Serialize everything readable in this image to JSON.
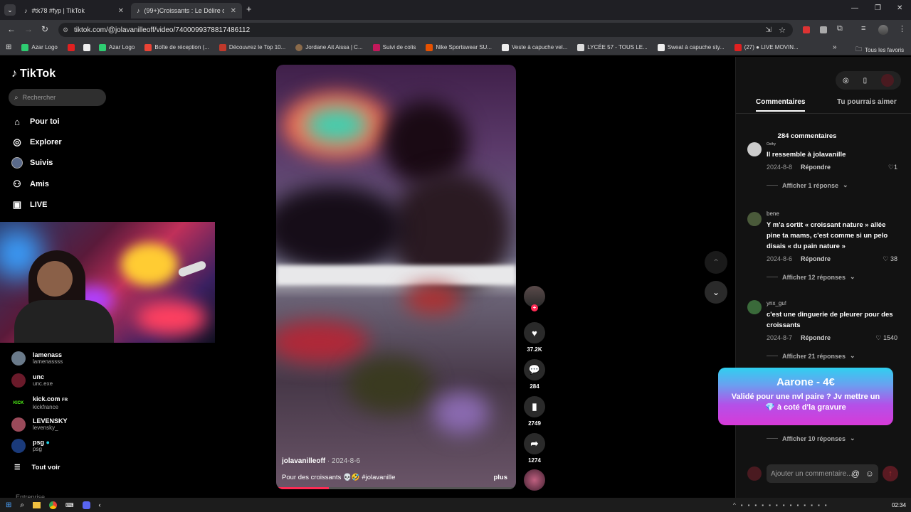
{
  "browser": {
    "tabs": [
      {
        "label": "#tk78 #fyp | TikTok"
      },
      {
        "label": "(99+)Croissants : Le Délire de M"
      }
    ],
    "url": "tiktok.com/@jolavanilleoff/video/7400099378817486112",
    "bookmarks": [
      {
        "label": "Azar Logo"
      },
      {
        "label": ""
      },
      {
        "label": ""
      },
      {
        "label": "Azar Logo"
      },
      {
        "label": "Boîte de réception (..."
      },
      {
        "label": "Découvrez le Top 10..."
      },
      {
        "label": "Jordane Ait Aissa | C..."
      },
      {
        "label": "Suivi de colis"
      },
      {
        "label": "Nike Sportswear SU..."
      },
      {
        "label": "Veste à capuche vel..."
      },
      {
        "label": "LYCÉE 57 - TOUS LE..."
      },
      {
        "label": "Sweat à capuche sty..."
      },
      {
        "label": "(27) ● LIVE MOVIN..."
      }
    ],
    "all_favorites": "Tous les favoris"
  },
  "tiktok": {
    "logo": "TikTok",
    "search_placeholder": "Rechercher",
    "nav": [
      {
        "label": "Pour toi",
        "icon": "home-icon"
      },
      {
        "label": "Explorer",
        "icon": "compass-icon"
      },
      {
        "label": "Suivis",
        "icon": "following-icon"
      },
      {
        "label": "Amis",
        "icon": "friends-icon"
      },
      {
        "label": "LIVE",
        "icon": "live-icon"
      }
    ],
    "accounts": [
      {
        "name": "lamenass",
        "handle": "lamenassss"
      },
      {
        "name": "unc",
        "handle": "unc.exe"
      },
      {
        "name": "kick.com",
        "badge": "FR",
        "handle": "kickfrance"
      },
      {
        "name": "LEVENSKY",
        "handle": "levensky_"
      },
      {
        "name": "psg",
        "handle": "psg"
      }
    ],
    "see_all": "Tout voir",
    "footer_label": "Entreprise"
  },
  "video": {
    "author": "jolavanilleoff",
    "date": "2024-8-6",
    "caption": "Pour des croissants 💀🤣 #jolavanille",
    "more": "plus",
    "likes": "37.2K",
    "comments": "284",
    "saves": "2749",
    "shares": "1274",
    "progress": 0.22
  },
  "panel": {
    "tabs": [
      "Commentaires",
      "Tu pourrais aimer"
    ],
    "count_label": "284 commentaires",
    "reply_label": "Répondre",
    "comments": [
      {
        "user": "Oxthy",
        "text": "Il ressemble à jolavanille",
        "date": "2024-8-8",
        "likes": "1",
        "replies": "Afficher 1 réponse"
      },
      {
        "user": "bene",
        "text": "Y m'a sortit «  croissant nature » allée pine ta mams, c'est comme si un pelo disais « du pain nature »",
        "date": "2024-8-6",
        "likes": "38",
        "replies": "Afficher 12 réponses"
      },
      {
        "user": "ynx_gu!",
        "text": "c'est une dinguerie de pleurer pour des croissants",
        "date": "2024-8-7",
        "likes": "1540",
        "replies": "Afficher 21 réponses"
      }
    ],
    "hidden_replies": "Afficher 10 réponses",
    "add_comment_placeholder": "Ajouter un commentaire..."
  },
  "donation": {
    "title": "Aarone - 4€",
    "message": "Validé pour une nvl paire ? Jv mettre un 💎 à coté d'la gravure"
  },
  "taskbar": {
    "time": "02:34"
  }
}
